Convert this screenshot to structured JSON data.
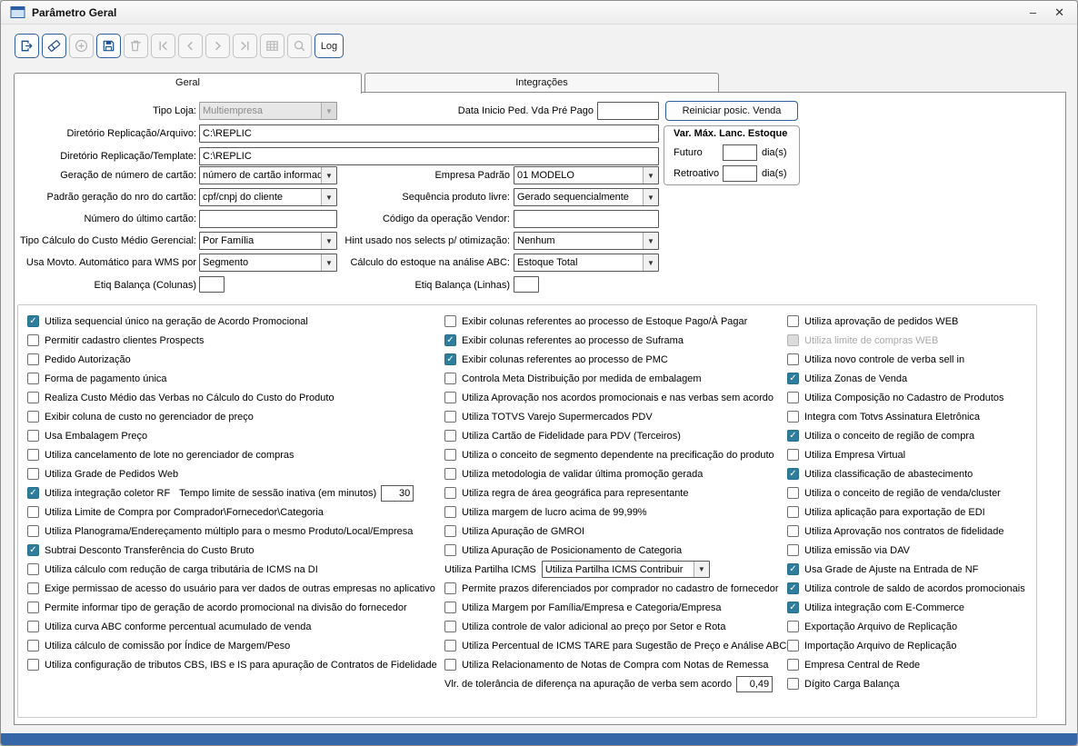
{
  "window": {
    "title": "Parâmetro Geral",
    "minimize_glyph": "–",
    "close_glyph": "✕"
  },
  "colors": {
    "checkbox_checked": "#2e7d9c",
    "toolbar_accent": "#2e5f9e",
    "bottom_bar": "#3566a8"
  },
  "toolbar": {
    "buttons": [
      {
        "name": "export",
        "icon": "export-icon",
        "enabled": true
      },
      {
        "name": "clear",
        "icon": "eraser-icon",
        "enabled": true
      },
      {
        "name": "add",
        "icon": "plus-icon",
        "enabled": false
      },
      {
        "name": "save",
        "icon": "save-icon",
        "enabled": true
      },
      {
        "name": "delete",
        "icon": "trash-icon",
        "enabled": false
      },
      {
        "name": "first-record",
        "icon": "first-record-icon",
        "enabled": false
      },
      {
        "name": "previous-record",
        "icon": "previous-record-icon",
        "enabled": false
      },
      {
        "name": "next-record",
        "icon": "next-record-icon",
        "enabled": false
      },
      {
        "name": "last-record",
        "icon": "last-record-icon",
        "enabled": false
      },
      {
        "name": "grid",
        "icon": "grid-icon",
        "enabled": false
      },
      {
        "name": "search",
        "icon": "search-icon",
        "enabled": false
      },
      {
        "name": "log",
        "label": "Log",
        "enabled": true
      }
    ]
  },
  "tabs": [
    {
      "label": "Geral",
      "active": true
    },
    {
      "label": "Integrações",
      "active": false
    }
  ],
  "form": {
    "tipo_loja": {
      "label": "Tipo Loja:",
      "value": "Multiempresa"
    },
    "data_inicio": {
      "label": "Data Inicio Ped. Vda Pré Pago",
      "value": ""
    },
    "reiniciar_button_label": "Reiniciar posic. Venda",
    "dir_replicacao_arquivo": {
      "label": "Diretório Replicação/Arquivo:",
      "value": "C:\\REPLIC"
    },
    "dir_replicacao_template": {
      "label": "Diretório Replicação/Template:",
      "value": "C:\\REPLIC"
    },
    "var_max_lanc_estoque": {
      "title": "Var. Máx. Lanc. Estoque",
      "futuro_label": "Futuro",
      "futuro_value": "",
      "retroativo_label": "Retroativo",
      "retroativo_value": "",
      "dias_label": "dia(s)"
    },
    "geracao_numero_cartao": {
      "label": "Geração de número de cartão:",
      "value": "número de cartão informado"
    },
    "empresa_padrao": {
      "label": "Empresa Padrão",
      "value": "01 MODELO"
    },
    "padrao_geracao_nro_cartao": {
      "label": "Padrão geração do nro do cartão:",
      "value": "cpf/cnpj do cliente"
    },
    "sequencia_produto_livre": {
      "label": "Sequência produto livre:",
      "value": "Gerado sequencialmente"
    },
    "numero_ultimo_cartao": {
      "label": "Número do último cartão:",
      "value": ""
    },
    "codigo_operacao_vendor": {
      "label": "Código da operação Vendor:",
      "value": ""
    },
    "tipo_calculo_custo": {
      "label": "Tipo Cálculo do Custo Médio Gerencial:",
      "value": "Por Família"
    },
    "hint_selects": {
      "label": "Hint usado nos selects p/ otimização:",
      "value": "Nenhum"
    },
    "movto_wms": {
      "label": "Usa Movto. Automático para WMS por",
      "value": "Segmento"
    },
    "calculo_estoque_abc": {
      "label": "Cálculo do estoque na análise ABC:",
      "value": "Estoque Total"
    },
    "etiq_balanca_colunas": {
      "label": "Etiq Balança (Colunas)",
      "value": ""
    },
    "etiq_balanca_linhas": {
      "label": "Etiq Balança (Linhas)",
      "value": ""
    }
  },
  "checkbox_columns": [
    [
      {
        "label": "Utiliza sequencial único na geração de Acordo Promocional",
        "checked": true
      },
      {
        "label": "Permitir cadastro clientes Prospects",
        "checked": false
      },
      {
        "label": "Pedido Autorização",
        "checked": false
      },
      {
        "label": "Forma de pagamento única",
        "checked": false
      },
      {
        "label": "Realiza Custo Médio das Verbas no Cálculo do Custo do Produto",
        "checked": false
      },
      {
        "label": "Exibir coluna de custo no gerenciador de preço",
        "checked": false
      },
      {
        "label": "Usa Embalagem Preço",
        "checked": false
      },
      {
        "label": "Utiliza cancelamento de lote no gerenciador de compras",
        "checked": false
      },
      {
        "label": "Utiliza Grade de Pedidos Web",
        "checked": false
      },
      {
        "label": "Utiliza integração coletor RF",
        "checked": true,
        "extra_label": "Tempo limite de sessão inativa (em minutos)",
        "extra_value": "30",
        "extra_width": 36
      },
      {
        "label": "Utiliza Limite de Compra por Comprador\\Fornecedor\\Categoria",
        "checked": false
      },
      {
        "label": "Utiliza Planograma/Endereçamento múltiplo para o mesmo Produto/Local/Empresa",
        "checked": false
      },
      {
        "label": "Subtrai Desconto Transferência do Custo Bruto",
        "checked": true
      },
      {
        "label": "Utiliza cálculo com redução de carga tributária de ICMS na DI",
        "checked": false
      },
      {
        "label": "Exige permissao de acesso do usuário para ver dados de outras empresas no aplicativo",
        "checked": false
      },
      {
        "label": "Permite informar tipo de geração de acordo promocional na divisão do fornecedor",
        "checked": false
      },
      {
        "label": "Utiliza curva ABC conforme percentual acumulado de venda",
        "checked": false
      },
      {
        "label": "Utiliza cálculo de comissão por Índice de Margem/Peso",
        "checked": false
      },
      {
        "label": "Utiliza configuração de tributos CBS, IBS e IS para apuração de Contratos de Fidelidade",
        "checked": false
      }
    ],
    [
      {
        "label": "Exibir colunas referentes ao processo de Estoque Pago/À Pagar",
        "checked": false
      },
      {
        "label": "Exibir colunas referentes ao processo de Suframa",
        "checked": true
      },
      {
        "label": "Exibir colunas referentes ao processo de PMC",
        "checked": true
      },
      {
        "label": "Controla Meta Distribuição por medida de embalagem",
        "checked": false
      },
      {
        "label": "Utiliza Aprovação nos acordos promocionais e nas verbas sem acordo",
        "checked": false
      },
      {
        "label": "Utiliza TOTVS Varejo Supermercados PDV",
        "checked": false
      },
      {
        "label": "Utiliza Cartão de Fidelidade para PDV (Terceiros)",
        "checked": false
      },
      {
        "label": "Utiliza o conceito de segmento dependente na precificação do produto",
        "checked": false
      },
      {
        "label": "Utiliza metodologia de validar última promoção gerada",
        "checked": false
      },
      {
        "label": "Utiliza regra de área geográfica para representante",
        "checked": false
      },
      {
        "label": "Utiliza margem de lucro acima de 99,99%",
        "checked": false
      },
      {
        "label": "Utiliza Apuração de GMROI",
        "checked": false
      },
      {
        "label": "Utiliza Apuração de Posicionamento de Categoria",
        "checked": false
      },
      {
        "type": "combo",
        "name": "partilha-icms-select",
        "label": "Utiliza Partilha ICMS",
        "value": "Utiliza Partilha ICMS Contribuir",
        "width": 185
      },
      {
        "label": "Permite prazos diferenciados por comprador no cadastro de fornecedor",
        "checked": false
      },
      {
        "label": "Utiliza Margem por Família/Empresa e Categoria/Empresa",
        "checked": false
      },
      {
        "label": "Utiliza controle de valor adicional ao preço por Setor e Rota",
        "checked": false
      },
      {
        "label": "Utiliza Percentual de ICMS TARE para Sugestão de Preço e Análise ABC",
        "checked": false
      },
      {
        "label": "Utiliza Relacionamento de Notas de Compra com Notas de Remessa",
        "checked": false
      },
      {
        "type": "field",
        "name": "tolerancia-verba-input",
        "label": "Vlr. de tolerância de diferença na apuração de verba sem acordo",
        "value": "0,49",
        "width": 40
      }
    ],
    [
      {
        "label": "Utiliza aprovação de pedidos WEB",
        "checked": false
      },
      {
        "label": "Utiliza limite de compras WEB",
        "checked": false,
        "disabled": true
      },
      {
        "label": "Utiliza novo controle de verba sell in",
        "checked": false
      },
      {
        "label": "Utiliza Zonas de Venda",
        "checked": true
      },
      {
        "label": "Utiliza Composição no Cadastro de Produtos",
        "checked": false
      },
      {
        "label": "Integra com Totvs Assinatura Eletrônica",
        "checked": false
      },
      {
        "label": "Utiliza o conceito de região de compra",
        "checked": true
      },
      {
        "label": "Utiliza Empresa Virtual",
        "checked": false
      },
      {
        "label": "Utiliza classificação de abastecimento",
        "checked": true
      },
      {
        "label": "Utiliza o conceito de região de venda/cluster",
        "checked": false
      },
      {
        "label": "Utiliza aplicação para exportação de EDI",
        "checked": false
      },
      {
        "label": "Utiliza Aprovação nos contratos de fidelidade",
        "checked": false
      },
      {
        "label": "Utiliza emissão via DAV",
        "checked": false
      },
      {
        "label": "Usa Grade de Ajuste na Entrada de NF",
        "checked": true
      },
      {
        "label": "Utiliza controle de saldo de acordos promocionais",
        "checked": true
      },
      {
        "label": "Utiliza integração com E-Commerce",
        "checked": true
      },
      {
        "label": "Exportação Arquivo de Replicação",
        "checked": false
      },
      {
        "label": "Importação Arquivo de Replicação",
        "checked": false
      },
      {
        "label": "Empresa Central de Rede",
        "checked": false
      },
      {
        "label": "Dígito Carga Balança",
        "checked": false
      }
    ]
  ]
}
